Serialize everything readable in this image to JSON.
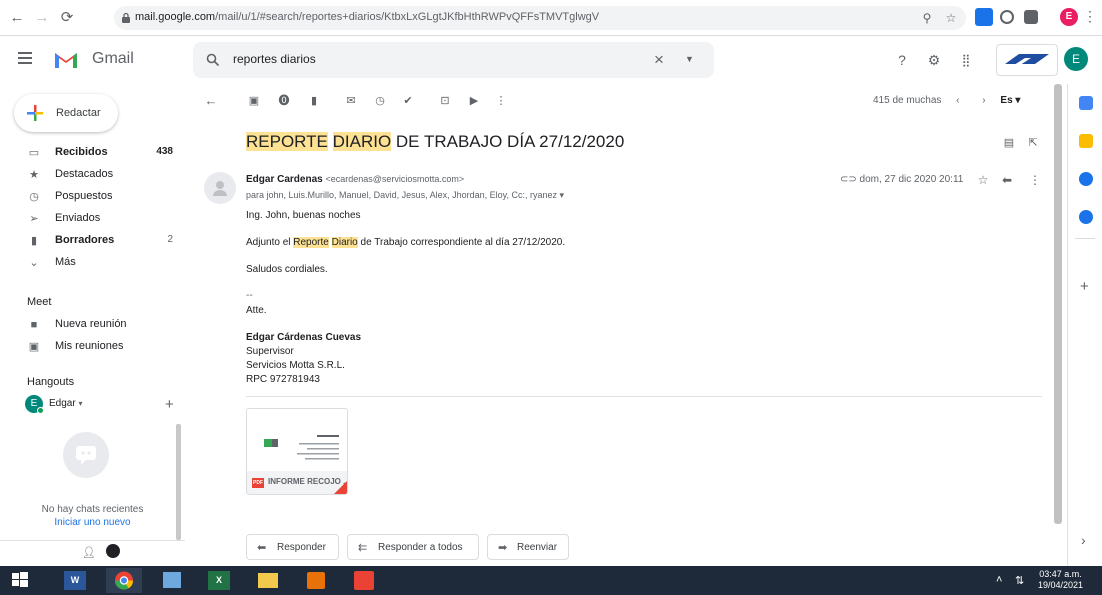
{
  "browser": {
    "url_host": "mail.google.com",
    "url_path": "/mail/u/1/#search/reportes+diarios/KtbxLxGLgtJKfbHthRWPvQFFsTMVTglwgV",
    "profile_initial": "E"
  },
  "header": {
    "product": "Gmail",
    "search_value": "reportes diarios",
    "account_initial": "E"
  },
  "sidebar": {
    "compose_label": "Redactar",
    "items": [
      {
        "label": "Recibidos",
        "count": "438",
        "icon": "inbox-icon",
        "bold": true
      },
      {
        "label": "Destacados",
        "count": "",
        "icon": "star-icon",
        "bold": false
      },
      {
        "label": "Pospuestos",
        "count": "",
        "icon": "clock-icon",
        "bold": false
      },
      {
        "label": "Enviados",
        "count": "",
        "icon": "send-icon",
        "bold": false
      },
      {
        "label": "Borradores",
        "count": "2",
        "icon": "draft-icon",
        "bold": true
      },
      {
        "label": "Más",
        "count": "",
        "icon": "chevron-down-icon",
        "bold": false
      }
    ],
    "meet_title": "Meet",
    "meet_items": [
      {
        "label": "Nueva reunión",
        "icon": "video-icon"
      },
      {
        "label": "Mis reuniones",
        "icon": "calendar-icon"
      }
    ],
    "hangouts_title": "Hangouts",
    "hangouts_user": "Edgar",
    "hangouts_user_initial": "E",
    "no_chats_text": "No hay chats recientes",
    "new_chat_link": "Iniciar uno nuevo"
  },
  "toolbar": {
    "pager_text": "415 de muchas",
    "lang_label": "Es"
  },
  "email": {
    "subject_part1": "REPORTE",
    "subject_part2": "DIARIO",
    "subject_part3": "DE TRABAJO DÍA 27/12/2020",
    "sender_name": "Edgar Cardenas",
    "sender_email": "<ecardenas@serviciosmotta.com>",
    "recipients": "para john, Luis.Murillo, Manuel, David, Jesus, Alex, Jhordan, Eloy, Cc:, ryanez",
    "date": "dom, 27 dic 2020 20:11",
    "greeting": "Ing. John, buenas noches",
    "body_pre": "Adjunto el",
    "body_hl1": "Reporte",
    "body_hl2": "Diario",
    "body_post": "de Trabajo correspondiente al día 27/12/2020.",
    "closing": "Saludos cordiales.",
    "sig_dash": "--",
    "sig_atte": "Atte.",
    "sig_name": "Edgar Cárdenas Cuevas",
    "sig_role": "Supervisor",
    "sig_company": "Servicios Motta S.R.L.",
    "sig_rpc": "RPC 972781943",
    "attachment_name": "INFORME RECOJO ...",
    "attachment_badge": "PDF"
  },
  "actions": {
    "reply": "Responder",
    "reply_all": "Responder a todos",
    "forward": "Reenviar"
  },
  "taskbar": {
    "time": "03:47 a.m.",
    "date": "19/04/2021"
  },
  "colors": {
    "highlight": "#fde293",
    "link": "#1a73e8",
    "taskbar": "#1e2a3a"
  }
}
